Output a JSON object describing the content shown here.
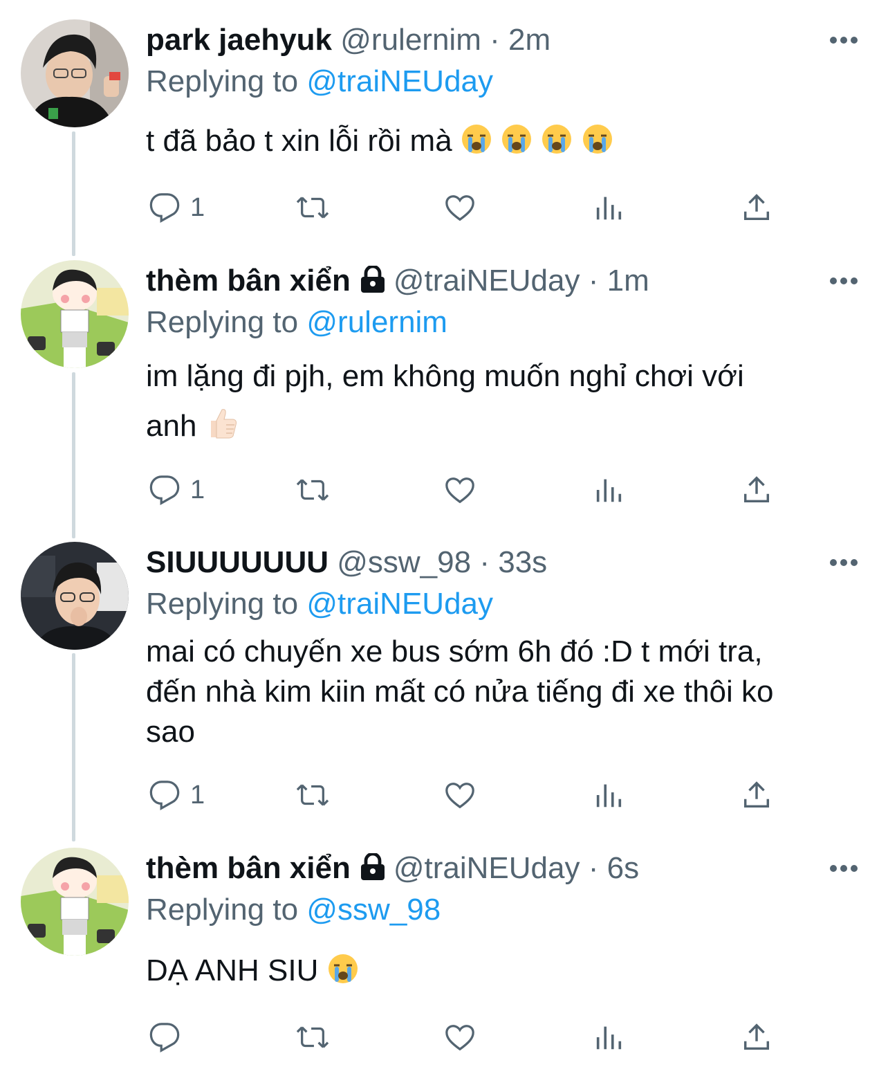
{
  "tweets": [
    {
      "name": "park jaehyuk",
      "handle": "@rulernim",
      "separator": "·",
      "time": "2m",
      "replying_prefix": "Replying to",
      "replying_to": "@traiNEUday",
      "text": "t đã bảo t xin lỗi rồi mà",
      "reply_count": "1",
      "protected": false,
      "avatar_icon": "photo-avatar-icon"
    },
    {
      "name": "thèm bân xiển",
      "handle": "@traiNEUday",
      "separator": "·",
      "time": "1m",
      "replying_prefix": "Replying to",
      "replying_to": "@rulernim",
      "text_line1": "im lặng đi pjh, em không muốn nghỉ chơi với",
      "text_line2": "anh",
      "reply_count": "1",
      "protected": true,
      "avatar_icon": "cartoon-avatar-icon"
    },
    {
      "name": "SIUUUUUUU",
      "handle": "@ssw_98",
      "separator": "·",
      "time": "33s",
      "replying_prefix": "Replying to",
      "replying_to": "@traiNEUday",
      "text_line1": "mai có chuyến xe bus sớm 6h đó :D t mới tra,",
      "text_line2": "đến nhà kim kiin mất có nửa tiếng đi xe thôi ko",
      "text_line3": "sao",
      "reply_count": "1",
      "protected": false,
      "avatar_icon": "photo-avatar-icon"
    },
    {
      "name": "thèm bân xiển",
      "handle": "@traiNEUday",
      "separator": "·",
      "time": "6s",
      "replying_prefix": "Replying to",
      "replying_to": "@ssw_98",
      "text": "DẠ ANH SIU",
      "reply_count": "",
      "protected": true,
      "avatar_icon": "cartoon-avatar-icon"
    }
  ],
  "icons": {
    "reply": "reply-icon",
    "retweet": "retweet-icon",
    "like": "like-icon",
    "views": "views-icon",
    "share": "share-icon",
    "more": "more-icon",
    "lock": "lock-icon",
    "emoji_cry": "loudly-crying-face-icon",
    "emoji_thumbs": "thumbs-up-icon"
  },
  "colors": {
    "accent": "#1d9bf0",
    "secondary_text": "#536471",
    "thread_line": "#cfd9de"
  }
}
